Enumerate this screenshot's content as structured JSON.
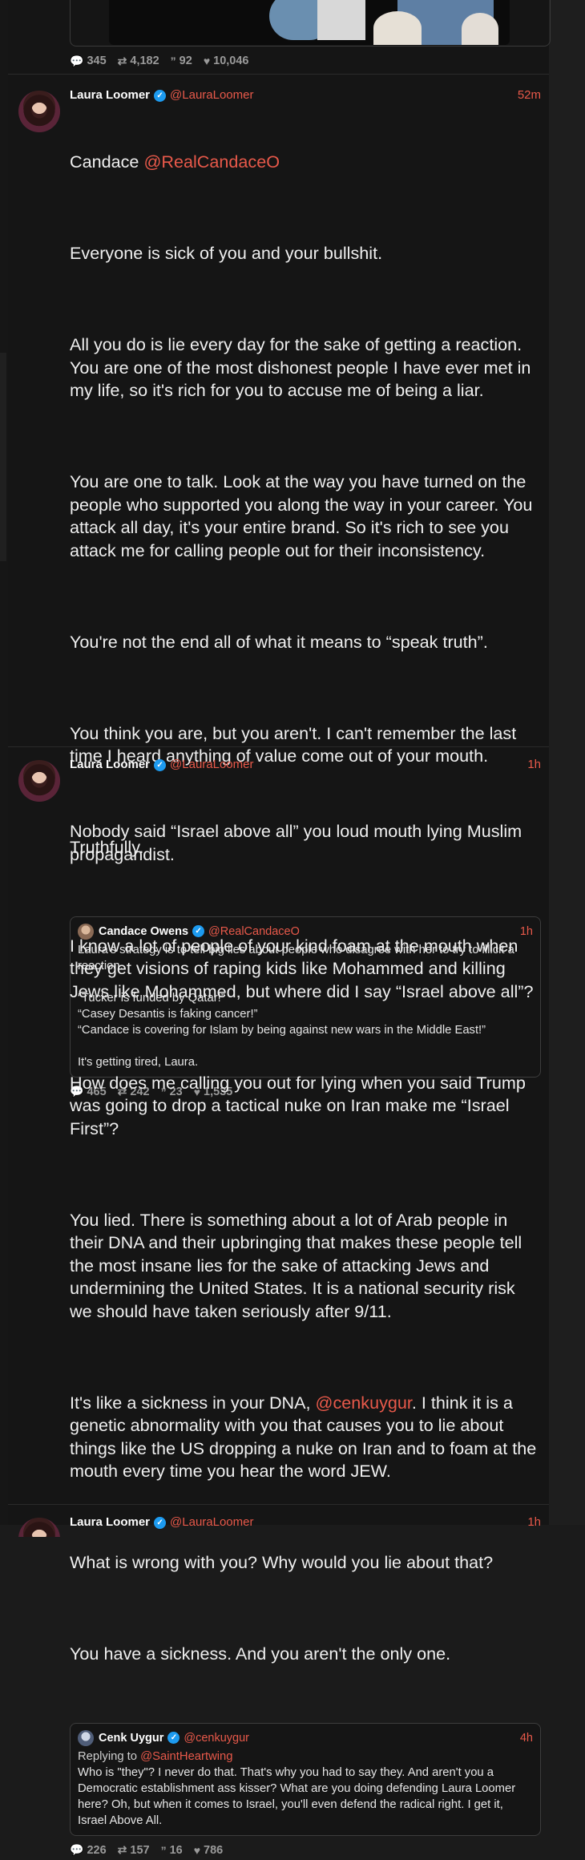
{
  "top_tweet": {
    "stats": {
      "replies": "345",
      "retweets": "4,182",
      "quotes": "92",
      "likes": "10,046"
    }
  },
  "tweet1": {
    "name": "Laura Loomer",
    "handle": "@LauraLoomer",
    "time": "52m",
    "opener_text": "Candace ",
    "opener_mention": "@RealCandaceO",
    "paragraphs": [
      "Everyone is sick of you and your bullshit.",
      "All you do is lie every day for the sake of getting a reaction. You are one of the most dishonest people I have ever met in my life, so it's rich for you to accuse me of being a liar.",
      "You are one to talk. Look at the way you have turned on the people who supported you along the way in your career. You attack all day, it's your entire brand. So it's rich to see you attack me for calling people out for their inconsistency.",
      "You're not the end all of what it means to “speak truth”.",
      "You think you are, but you aren't. I can't remember the last time I heard anything of value come out of your mouth.",
      "Truthfully."
    ],
    "quote": {
      "name": "Candace Owens",
      "handle": "@RealCandaceO",
      "time": "1h",
      "paragraphs": [
        "Laura's strategy is to tell big lies about people who disagree with her to try to illicit a reaction.",
        "“Tucker is funded by Qatar!”\n“Casey Desantis is faking cancer!”\n“Candace is covering for Islam by being against new wars in the Middle East!”",
        "It's getting tired, Laura."
      ]
    },
    "stats": {
      "replies": "465",
      "retweets": "242",
      "quotes": "23",
      "likes": "1,535"
    }
  },
  "tweet2": {
    "name": "Laura Loomer",
    "handle": "@LauraLoomer",
    "time": "1h",
    "p1": "Nobody said “Israel above all” you loud mouth lying Muslim propagandist.",
    "p2": "I know a lot of people of your kind foam at the mouth when they get visions of raping kids like Mohammed and killing Jews like Mohammed, but where did I say “Israel above all”?",
    "p3": "How does me calling you out for lying when you said Trump was going to drop a tactical nuke on Iran make me “Israel First”?",
    "p4": "You lied. There is something about a lot of Arab people in their DNA and their upbringing that makes these people tell the most insane lies for the sake of attacking Jews and undermining the United States. It is a national security risk we should have taken seriously after 9/11.",
    "p5_before": "It's like a sickness in your DNA, ",
    "p5_mention": "@cenkuygur",
    "p5_after": ". I think it is a genetic abnormality with you that causes you to lie about things like the US dropping a nuke on Iran and to foam at the mouth every time you hear the word JEW.",
    "p6": "What is wrong with you? Why would you lie about that?",
    "p7": "You have a sickness. And you aren't the only one.",
    "quote": {
      "name": "Cenk Uygur",
      "handle": "@cenkuygur",
      "time": "4h",
      "replying_label": "Replying to ",
      "replying_handle": "@SaintHeartwing",
      "text": "Who is \"they\"? I never do that. That's why you had to say they. And aren't you a Democratic establishment ass kisser? What are you doing defending Laura Loomer here? Oh, but when it comes to Israel, you'll even defend the radical right. I get it, Israel Above All."
    },
    "stats": {
      "replies": "226",
      "retweets": "157",
      "quotes": "16",
      "likes": "786"
    }
  },
  "tweet3": {
    "name": "Laura Loomer",
    "handle": "@LauraLoomer",
    "time": "1h"
  },
  "icons": {
    "reply": "💬",
    "retweet": "⇄",
    "quote": "”",
    "like": "♥",
    "verified": "✓"
  }
}
